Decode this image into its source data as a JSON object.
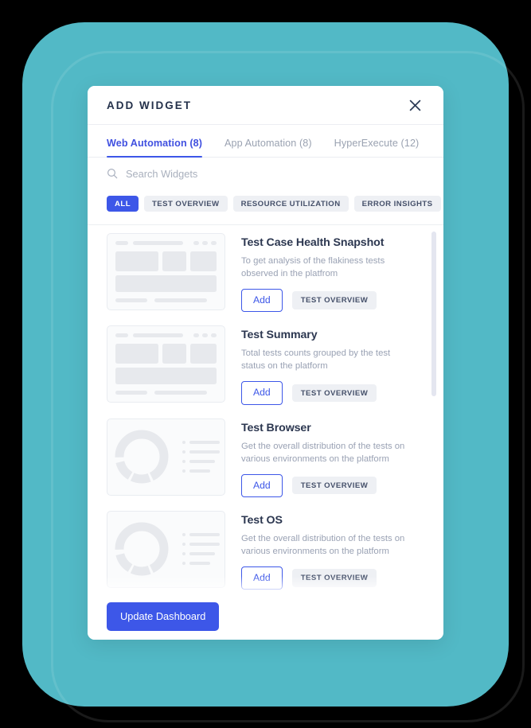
{
  "theme": {
    "backdrop_color": "#52b9c6",
    "accent_color": "#3d57e8",
    "chip_bg": "#eef0f4",
    "title_color": "#23304a",
    "muted_text": "#9aa2b4"
  },
  "modal": {
    "title": "ADD WIDGET",
    "close_icon": "close-icon"
  },
  "tabs": [
    {
      "label": "Web Automation (8)",
      "active": true
    },
    {
      "label": "App Automation (8)",
      "active": false
    },
    {
      "label": "HyperExecute (12)",
      "active": false
    }
  ],
  "search": {
    "icon": "search-icon",
    "placeholder": "Search Widgets",
    "value": ""
  },
  "filters": [
    {
      "label": "ALL",
      "active": true
    },
    {
      "label": "TEST OVERVIEW",
      "active": false
    },
    {
      "label": "RESOURCE UTILIZATION",
      "active": false
    },
    {
      "label": "ERROR INSIGHTS",
      "active": false
    }
  ],
  "widgets": [
    {
      "title": "Test Case Health Snapshot",
      "description": "To get analysis of the flakiness tests observed in the platfrom",
      "add_label": "Add",
      "category": "TEST OVERVIEW",
      "thumb_type": "layout"
    },
    {
      "title": "Test Summary",
      "description": "Total tests counts grouped by the test status on the platform",
      "add_label": "Add",
      "category": "TEST OVERVIEW",
      "thumb_type": "layout"
    },
    {
      "title": "Test Browser",
      "description": "Get the overall distribution of the tests on various environments on the platform",
      "add_label": "Add",
      "category": "TEST OVERVIEW",
      "thumb_type": "donut"
    },
    {
      "title": "Test OS",
      "description": "Get the overall distribution of the tests on various environments on the platform",
      "add_label": "Add",
      "category": "TEST OVERVIEW",
      "thumb_type": "donut"
    }
  ],
  "footer": {
    "update_label": "Update Dashboard"
  }
}
